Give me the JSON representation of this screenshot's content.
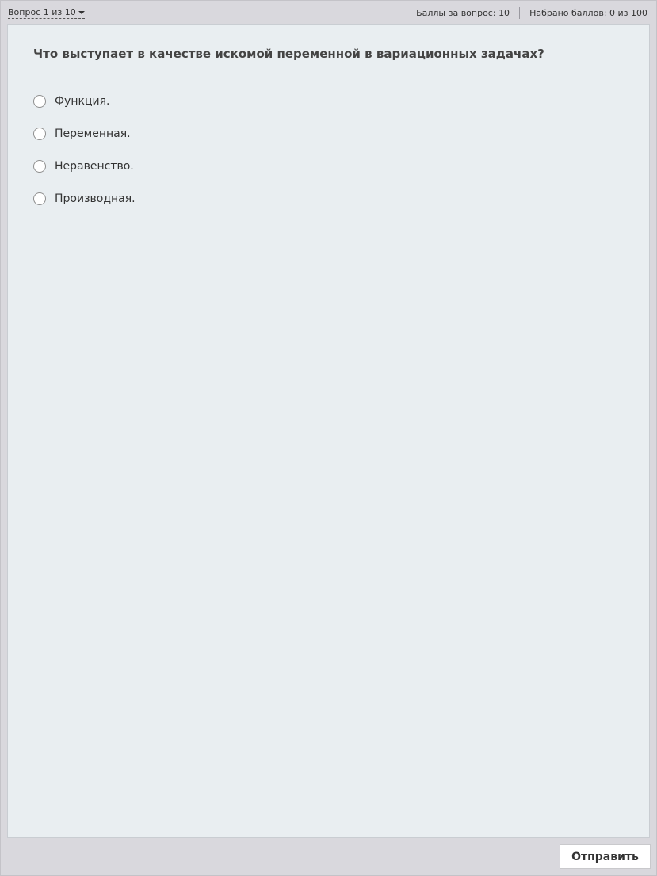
{
  "header": {
    "question_nav": "Вопрос 1 из 10",
    "points_per_question": "Баллы за вопрос: 10",
    "points_scored": "Набрано баллов: 0 из 100"
  },
  "question": {
    "text": "Что выступает в качестве искомой переменной в вариационных задачах?",
    "options": [
      {
        "label": "Функция.",
        "selected": false
      },
      {
        "label": "Переменная.",
        "selected": false
      },
      {
        "label": "Неравенство.",
        "selected": false
      },
      {
        "label": "Производная.",
        "selected": false
      }
    ]
  },
  "footer": {
    "submit_label": "Отправить"
  },
  "colors": {
    "frame_background": "#d9d8dd",
    "card_background": "#e9eef1",
    "text": "#333333"
  }
}
